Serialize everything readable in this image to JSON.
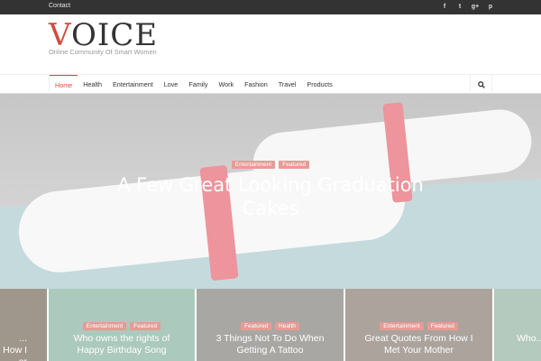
{
  "topbar": {
    "contact": "Contact",
    "social": [
      {
        "icon": "facebook-icon",
        "glyph": "f"
      },
      {
        "icon": "twitter-icon",
        "glyph": "t"
      },
      {
        "icon": "google-plus-icon",
        "glyph": "g+"
      },
      {
        "icon": "pinterest-icon",
        "glyph": "p"
      }
    ]
  },
  "header": {
    "logo_first": "V",
    "logo_rest": "OICE",
    "tagline": "Online Community Of Smart Women"
  },
  "nav": {
    "items": [
      "Home",
      "Health",
      "Entertainment",
      "Love",
      "Family",
      "Work",
      "Fashion",
      "Travel",
      "Products"
    ],
    "active": "Home"
  },
  "hero": {
    "tags": [
      "Entertainment",
      "Featured"
    ],
    "title": "A Few Great Looking Graduation Cakes"
  },
  "cards": [
    {
      "tags": [],
      "title": "... How I\n...er"
    },
    {
      "tags": [
        "Entertainment",
        "Featured"
      ],
      "title": "Who owns the rights of\nHappy Birthday Song"
    },
    {
      "tags": [
        "Featured",
        "Health"
      ],
      "title": "3 Things Not To Do When\nGetting A Tattoo"
    },
    {
      "tags": [
        "Entertainment",
        "Featured"
      ],
      "title": "Great Quotes From How I\nMet Your Mother"
    },
    {
      "tags": [],
      "title": "Who..."
    }
  ],
  "colors": {
    "accent": "#d24b3b",
    "tag": "#e79b95",
    "topbar": "#333333"
  }
}
